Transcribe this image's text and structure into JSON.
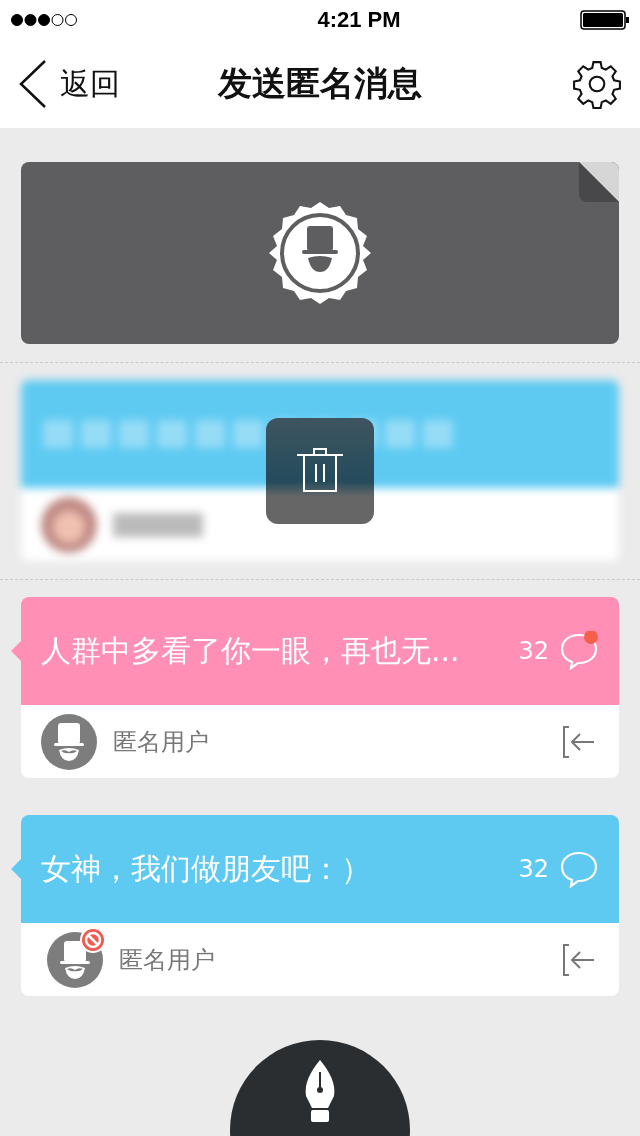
{
  "status_bar": {
    "time": "4:21 PM"
  },
  "nav": {
    "back": "返回",
    "title": "发送匿名消息"
  },
  "messages": [
    {
      "kind": "blurred",
      "color": "#5ecaf2"
    },
    {
      "kind": "normal",
      "color": "#ff8fb4",
      "text": "人群中多看了你一眼，再也无...",
      "count": "32",
      "unread": true,
      "user": "匿名用户",
      "blocked": false
    },
    {
      "kind": "normal",
      "color": "#5ecaf2",
      "text": "女神，我们做朋友吧：）",
      "count": "32",
      "unread": false,
      "user": "匿名用户",
      "blocked": true
    }
  ]
}
